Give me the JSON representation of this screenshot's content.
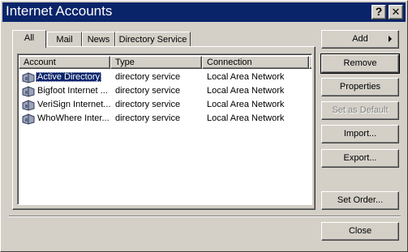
{
  "window": {
    "title": "Internet Accounts",
    "help_button": "?",
    "close_button": "✕"
  },
  "tabs": [
    {
      "label": "All",
      "active": true
    },
    {
      "label": "Mail",
      "active": false
    },
    {
      "label": "News",
      "active": false
    },
    {
      "label": "Directory Service",
      "active": false
    }
  ],
  "list": {
    "columns": [
      "Account",
      "Type",
      "Connection"
    ],
    "rows": [
      {
        "account": "Active Directory",
        "type": "directory service",
        "connection": "Local Area Network",
        "selected": true
      },
      {
        "account": "Bigfoot Internet ...",
        "type": "directory service",
        "connection": "Local Area Network",
        "selected": false
      },
      {
        "account": "VeriSign Internet...",
        "type": "directory service",
        "connection": "Local Area Network",
        "selected": false
      },
      {
        "account": "WhoWhere Inter...",
        "type": "directory service",
        "connection": "Local Area Network",
        "selected": false
      }
    ]
  },
  "buttons": {
    "add": "Add",
    "remove": "Remove",
    "properties": "Properties",
    "set_as_default": "Set as Default",
    "import": "Import...",
    "export": "Export...",
    "set_order": "Set Order...",
    "close": "Close"
  },
  "colors": {
    "titlebar": "#0a246a",
    "face": "#d4d0c8",
    "selection": "#0a246a"
  }
}
